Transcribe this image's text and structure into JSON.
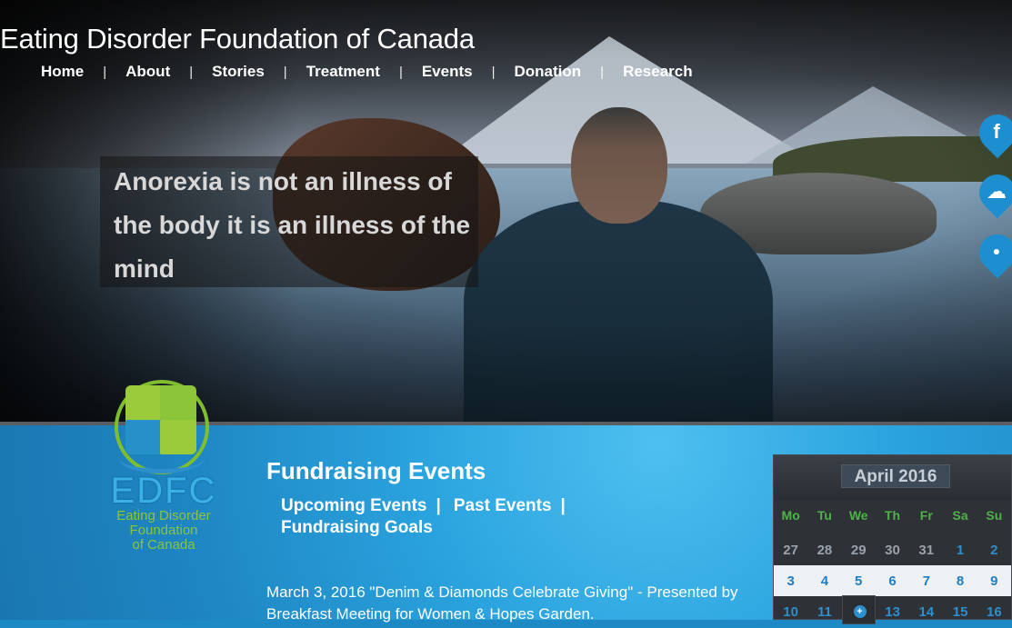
{
  "site": {
    "title": "Eating Disorder Foundation of Canada"
  },
  "nav": {
    "items": [
      "Home",
      "About",
      "Stories",
      "Treatment",
      "Events",
      "Donation",
      "Research"
    ]
  },
  "hero": {
    "quote": "Anorexia is not an illness of the body it is an illness of the mind"
  },
  "social": [
    {
      "icon": "facebook-icon",
      "glyph": "f"
    },
    {
      "icon": "chat-icon",
      "glyph": "☁"
    },
    {
      "icon": "location-icon",
      "glyph": "●"
    }
  ],
  "logo": {
    "abbr": "EDFC",
    "line1": "Eating Disorder",
    "line2": "Foundation",
    "line3": "of Canada"
  },
  "fundraising": {
    "title": "Fundraising Events",
    "links": [
      "Upcoming Events",
      "Past Events",
      "Fundraising Goals"
    ],
    "separator": "|",
    "event": "March 3, 2016 \"Denim & Diamonds Celebrate Giving\" - Presented by Breakfast Meeting for Women & Hopes Garden."
  },
  "calendar": {
    "month": "April 2016",
    "days": [
      "Mo",
      "Tu",
      "We",
      "Th",
      "Fr",
      "Sa",
      "Su"
    ],
    "week1": [
      "27",
      "28",
      "29",
      "30",
      "31",
      "1",
      "2"
    ],
    "week2": [
      "3",
      "4",
      "5",
      "6",
      "7",
      "8",
      "9"
    ],
    "week3": [
      "10",
      "11",
      "",
      "13",
      "14",
      "15",
      "16"
    ],
    "today_glyph": "+"
  },
  "colors": {
    "accent": "#1d8fd0",
    "green": "#4fb14a",
    "lower_bg": "#2aa3de"
  }
}
